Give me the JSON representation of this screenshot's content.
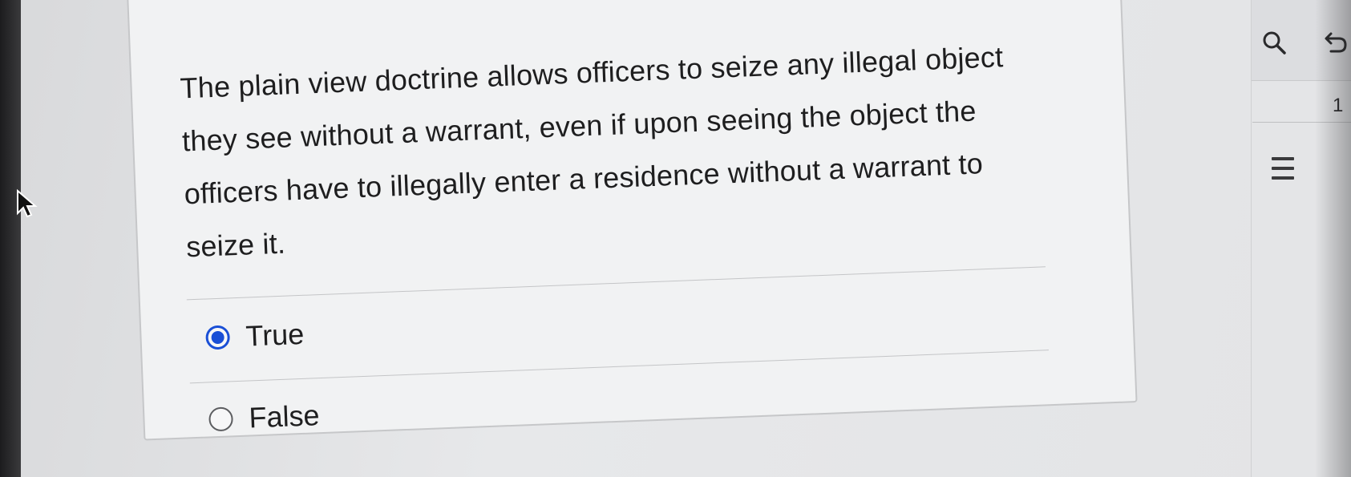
{
  "question": {
    "text": "The plain view doctrine allows officers to seize any illegal object they see without a warrant, even if upon seeing the object the officers have to illegally enter a residence without a warrant to seize it."
  },
  "options": [
    {
      "label": "True",
      "selected": true
    },
    {
      "label": "False",
      "selected": false
    }
  ],
  "sidebar": {
    "page_number": "1",
    "icons": [
      "search-icon",
      "undo-icon",
      "menu-icon"
    ]
  },
  "colors": {
    "accent": "#1a4fd6",
    "text": "#1e1e1f",
    "card_bg": "#f1f2f3"
  }
}
